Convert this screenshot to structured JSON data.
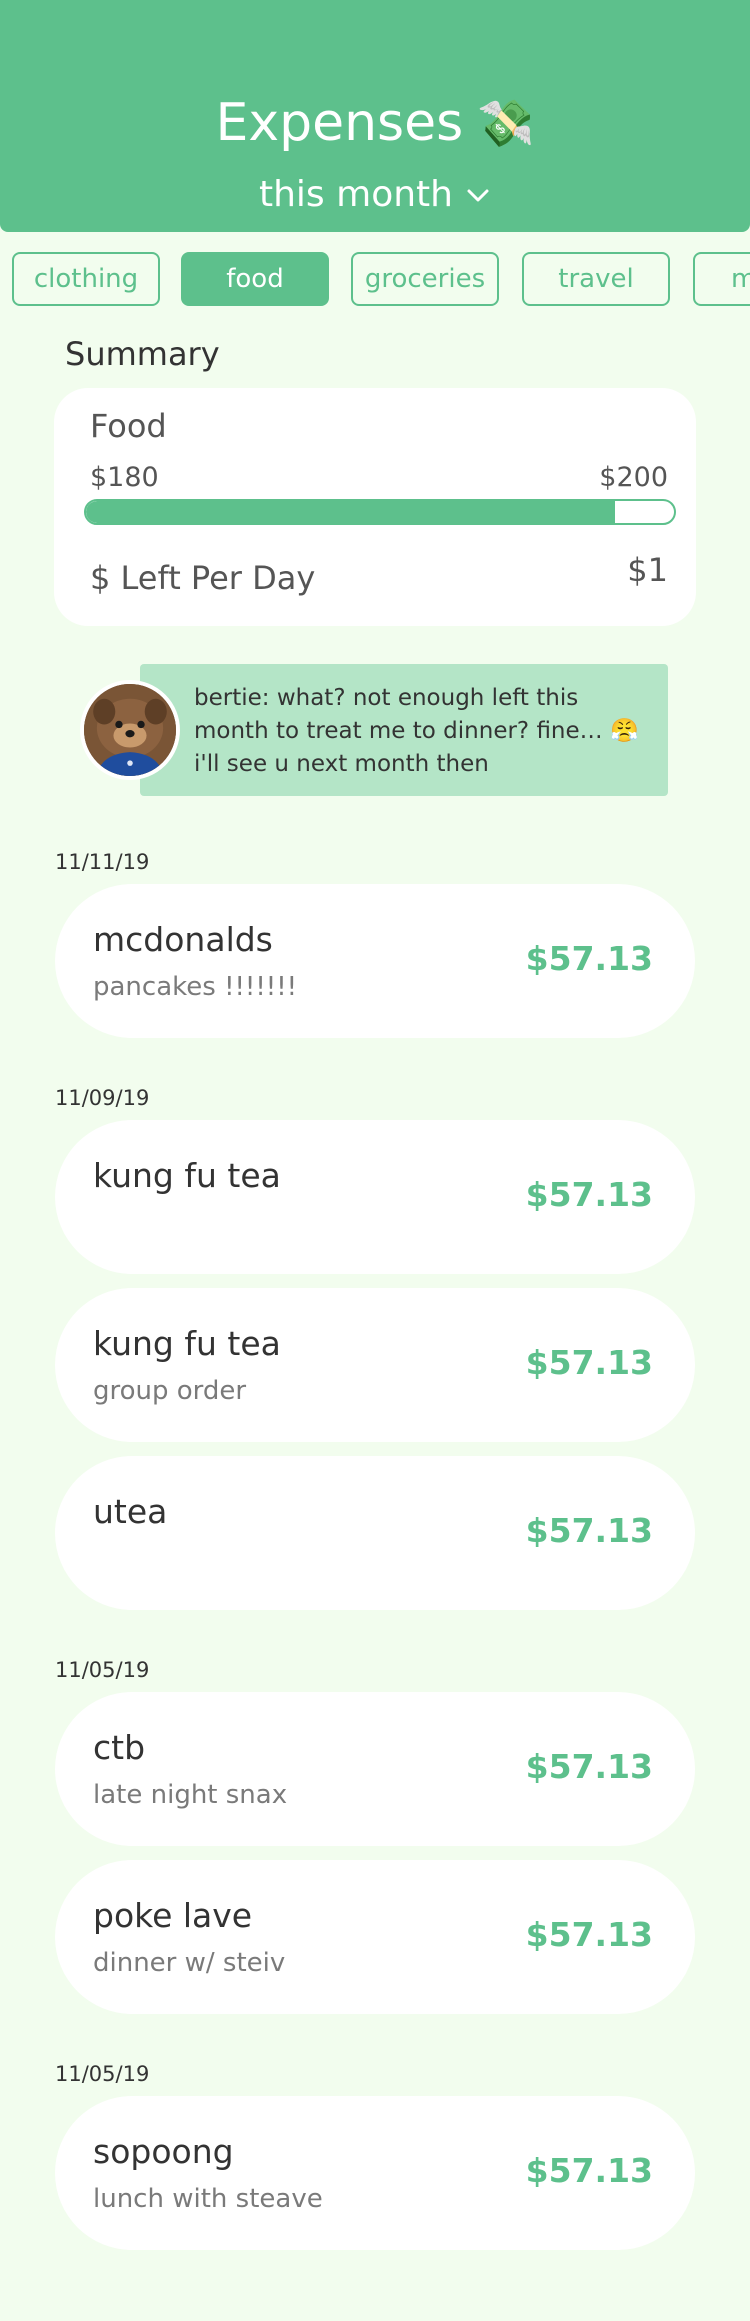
{
  "header": {
    "title": "Expenses",
    "title_icon": "💸",
    "period": "this month"
  },
  "tabs": [
    "clothing",
    "food",
    "groceries",
    "travel",
    "m"
  ],
  "active_tab": "food",
  "summary": {
    "heading": "Summary",
    "category": "Food",
    "spent": "$180",
    "budget": "$200",
    "progress_fraction": 0.9,
    "left_per_day_label": "$ Left Per Day",
    "left_per_day_value": "$1"
  },
  "pet_message": {
    "text": "bertie: what? not enough left this month to treat me to dinner? fine… 😤 i'll see u next month then"
  },
  "groups": [
    {
      "date": "11/11/19",
      "items": [
        {
          "name": "mcdonalds",
          "note": "pancakes !!!!!!!",
          "amount": "$57.13"
        }
      ]
    },
    {
      "date": "11/09/19",
      "items": [
        {
          "name": "kung fu tea",
          "note": "",
          "amount": "$57.13"
        },
        {
          "name": "kung fu tea",
          "note": "group order",
          "amount": "$57.13"
        },
        {
          "name": "utea",
          "note": "",
          "amount": "$57.13"
        }
      ]
    },
    {
      "date": "11/05/19",
      "items": [
        {
          "name": "ctb",
          "note": "late night snax",
          "amount": "$57.13"
        },
        {
          "name": "poke lave",
          "note": "dinner w/ steiv",
          "amount": "$57.13"
        }
      ]
    },
    {
      "date": "11/05/19",
      "items": [
        {
          "name": "sopoong",
          "note": "lunch with steave",
          "amount": "$57.13"
        }
      ]
    }
  ],
  "colors": {
    "accent": "#5dc08c",
    "background": "#f2fdee",
    "bubble": "#b4e5c7"
  }
}
